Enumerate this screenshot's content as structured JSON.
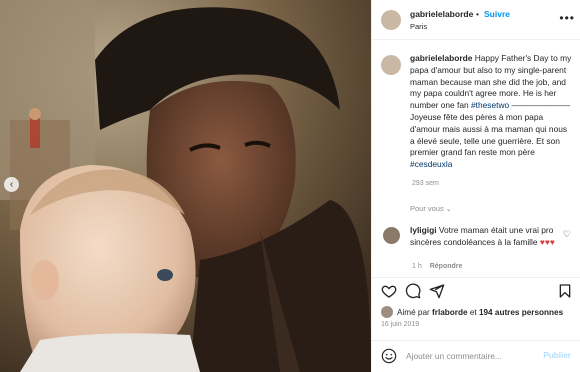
{
  "post": {
    "username": "gabrielelaborde",
    "separator": "•",
    "follow_label": "Suivre",
    "location": "Paris",
    "more_icon": "more-horizontal-icon"
  },
  "caption": {
    "username": "gabrielelaborde",
    "text_en": "Happy Father's Day to my papa d'amour but also to my single-parent maman because man she did the job, and my papa couldn't agree more. He is her number one fan",
    "hashtag_1": "#thesetwo",
    "divider": "———————",
    "text_fr": "Joyeuse fête des pères à mon papa d'amour mais aussi à ma maman qui nous a élevé seule, telle une guerrière. Et son premier grand fan reste mon père",
    "hashtag_2": "#cesdeuxla",
    "time": "293 sem"
  },
  "pour_vous": "Pour vous",
  "comment": {
    "username": "lyligigi",
    "text": "Votre maman était une vrai pro sincères condoléances à la famille",
    "hearts": "♥♥♥",
    "time": "1 h",
    "reply": "Répondre"
  },
  "likes": {
    "prefix": "Aimé par",
    "user": "frlaborde",
    "connector": "et",
    "others": "194 autres personnes"
  },
  "date": "16 juin 2019",
  "add_comment": {
    "placeholder": "Ajouter un commentaire...",
    "publish": "Publier"
  },
  "colors": {
    "accent": "#0095f6",
    "publish_disabled": "#b2dffc",
    "heart_red": "#d83b3b"
  },
  "icons": [
    "heart-icon",
    "comment-icon",
    "share-icon",
    "bookmark-icon",
    "emoji-icon",
    "carousel-prev-icon"
  ]
}
